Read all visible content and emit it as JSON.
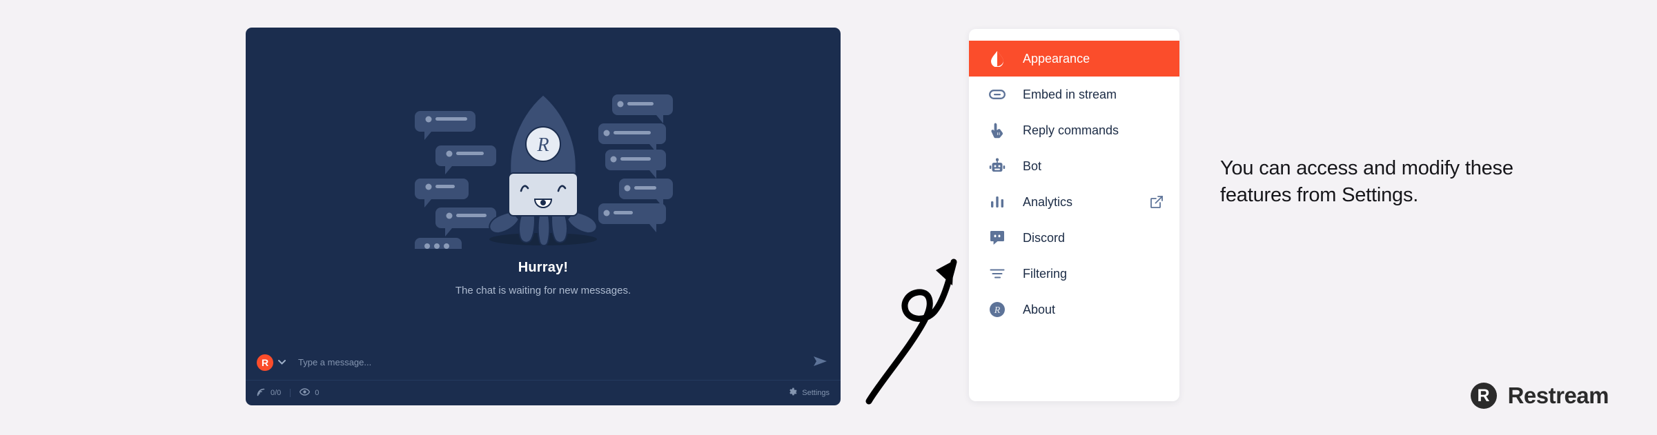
{
  "chat_window": {
    "empty_state": {
      "title": "Hurray!",
      "subtitle": "The chat is waiting for new messages.",
      "illustration_name": "rocket-robot-illustration",
      "badge_letter": "R"
    },
    "composer": {
      "avatar_letter": "R",
      "avatar_color": "#fb4d2b",
      "dropdown_icon": "chevron-down-icon",
      "input_placeholder": "Type a message...",
      "input_value": "",
      "send_icon": "send-icon"
    },
    "statusbar": {
      "connections_icon": "broadcast-icon",
      "connections_value": "0/0",
      "viewers_icon": "eye-icon",
      "viewers_value": "0",
      "settings_icon": "gear-icon",
      "settings_label": "Settings"
    },
    "background_color": "#1b2d4e"
  },
  "arrow": {
    "name": "curved-arrow",
    "color": "#000000"
  },
  "menu_panel": {
    "accent_color": "#fb4d2b",
    "items": [
      {
        "label": "Appearance",
        "icon": "droplet-half-icon",
        "active": true,
        "external": false
      },
      {
        "label": "Embed in stream",
        "icon": "link-icon",
        "active": false,
        "external": false
      },
      {
        "label": "Reply commands",
        "icon": "tap-hand-icon",
        "active": false,
        "external": false
      },
      {
        "label": "Bot",
        "icon": "robot-icon",
        "active": false,
        "external": false
      },
      {
        "label": "Analytics",
        "icon": "bar-chart-icon",
        "active": false,
        "external": true
      },
      {
        "label": "Discord",
        "icon": "discord-icon",
        "active": false,
        "external": false
      },
      {
        "label": "Filtering",
        "icon": "filter-icon",
        "active": false,
        "external": false
      },
      {
        "label": "About",
        "icon": "restream-r-icon",
        "active": false,
        "external": false
      }
    ],
    "external_icon": "external-link-icon"
  },
  "callout": {
    "text": "You can access and modify these features from Settings."
  },
  "brand": {
    "mark_letter": "R",
    "name": "Restream",
    "color": "#2b2b2b"
  }
}
